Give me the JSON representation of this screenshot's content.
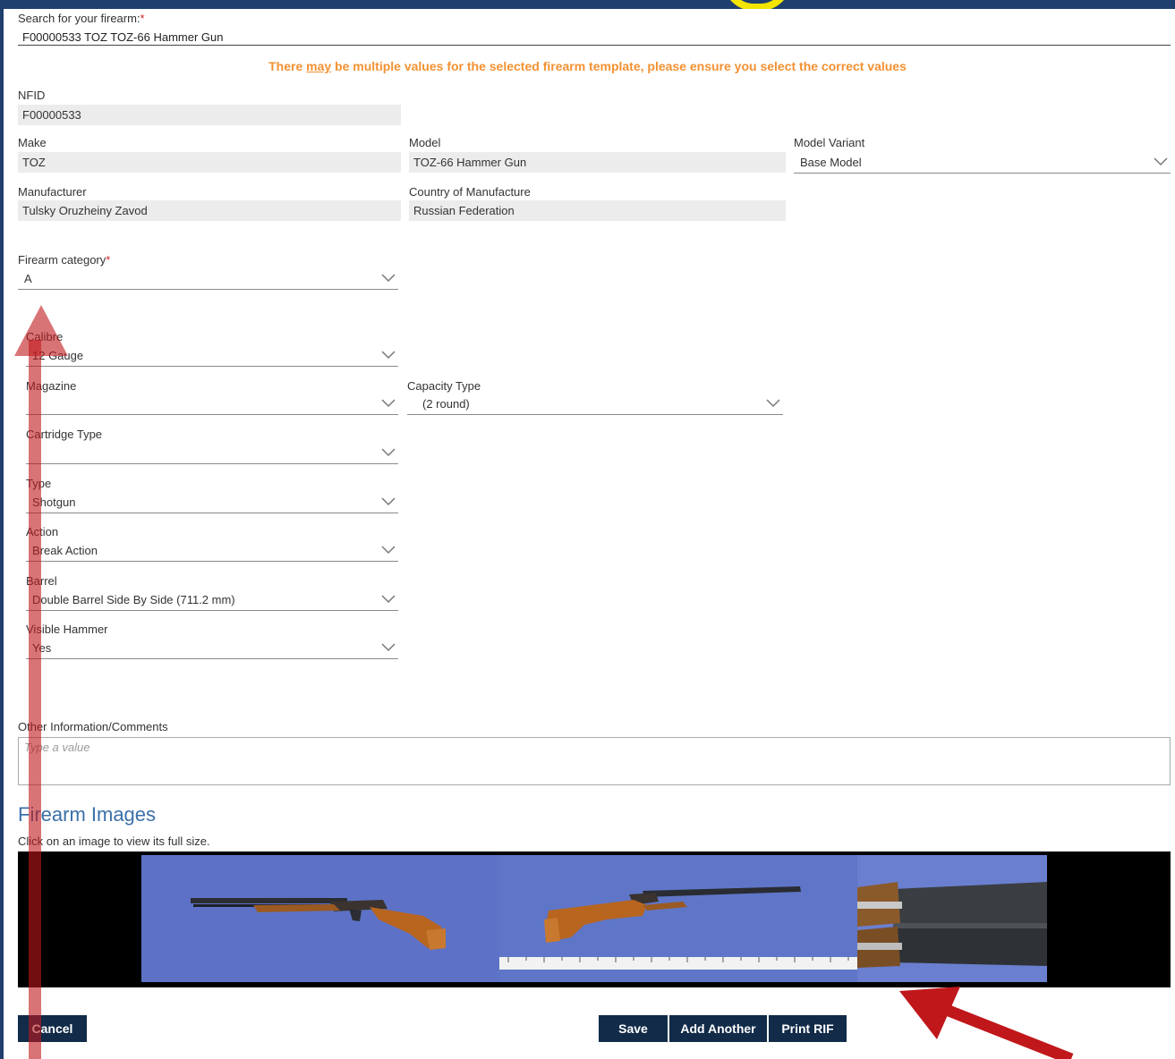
{
  "search": {
    "label": "Search for your firearm:",
    "required_mark": "*",
    "value": "F00000533 TOZ TOZ-66 Hammer Gun"
  },
  "warning": {
    "prefix": "There ",
    "emphasis": "may",
    "suffix": " be multiple values for the selected firearm template, please ensure you select the correct values"
  },
  "fields": {
    "nfid": {
      "label": "NFID",
      "value": "F00000533"
    },
    "make": {
      "label": "Make",
      "value": "TOZ"
    },
    "model": {
      "label": "Model",
      "value": "TOZ-66 Hammer Gun"
    },
    "model_variant": {
      "label": "Model Variant",
      "value": "Base Model"
    },
    "manufacturer": {
      "label": "Manufacturer",
      "value": "Tulsky Oruzheiny Zavod"
    },
    "country": {
      "label": "Country of Manufacture",
      "value": "Russian Federation"
    },
    "category": {
      "label": "Firearm category",
      "required_mark": "*",
      "value": "A"
    },
    "calibre": {
      "label": "Calibre",
      "value": "12 Gauge"
    },
    "magazine": {
      "label": "Magazine",
      "value": ""
    },
    "capacity_type": {
      "label": "Capacity Type",
      "value": "(2 round)"
    },
    "cartridge_type": {
      "label": "Cartridge Type",
      "value": ""
    },
    "type": {
      "label": "Type",
      "value": "Shotgun"
    },
    "action": {
      "label": "Action",
      "value": "Break Action"
    },
    "barrel": {
      "label": "Barrel",
      "value": "Double Barrel Side By Side (711.2 mm)"
    },
    "visible_hammer": {
      "label": "Visible Hammer",
      "value": "Yes"
    }
  },
  "comments": {
    "label": "Other Information/Comments",
    "placeholder": "Type a value"
  },
  "images": {
    "title": "Firearm Images",
    "hint": "Click on an image to view its full size."
  },
  "buttons": {
    "cancel": "Cancel",
    "save": "Save",
    "add_another": "Add Another",
    "print": "Print RIF"
  },
  "colors": {
    "header_bg": "#1f3f6e",
    "warning": "#f39132",
    "button_bg": "#112b49",
    "required": "#d9262b",
    "section_title": "#3a6fa8",
    "annotation_arrow": "#c0171b",
    "photo_bg": "#5d72c6"
  },
  "icons": {
    "dropdown": "chevron-down-icon",
    "annotation": "red-arrow-icon"
  }
}
